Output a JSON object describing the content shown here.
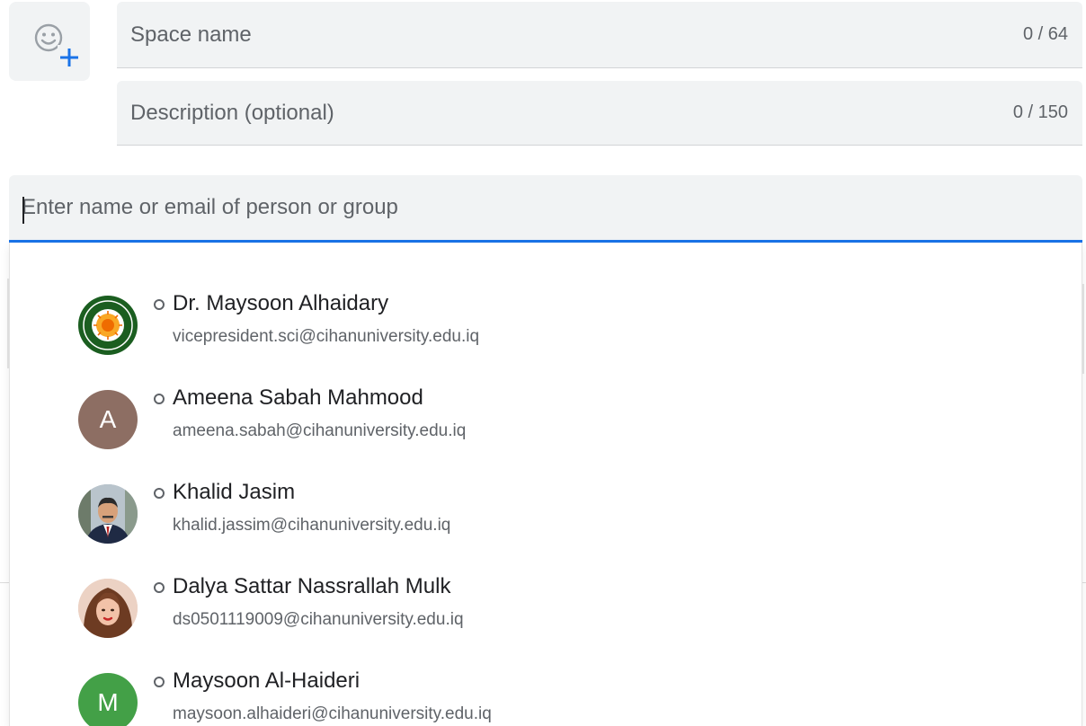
{
  "emoji_picker": {
    "icon": "add-emoji-icon"
  },
  "space_name": {
    "placeholder": "Space name",
    "value": "",
    "counter": "0 / 64"
  },
  "description": {
    "placeholder": "Description (optional)",
    "value": "",
    "counter": "0 / 150"
  },
  "people_search": {
    "placeholder": "Enter name or email of person or group",
    "value": ""
  },
  "colors": {
    "accent": "#1a73e8",
    "field_bg": "#f1f3f4",
    "avatar_a": "#8d6e63",
    "avatar_m": "#43a047"
  },
  "suggestions": [
    {
      "name": "Dr. Maysoon Alhaidary",
      "email": "vicepresident.sci@cihanuniversity.edu.iq",
      "avatar": "university-logo"
    },
    {
      "name": "Ameena Sabah Mahmood",
      "email": "ameena.sabah@cihanuniversity.edu.iq",
      "avatar": "A"
    },
    {
      "name": "Khalid Jasim",
      "email": "khalid.jassim@cihanuniversity.edu.iq",
      "avatar": "photo"
    },
    {
      "name": "Dalya Sattar Nassrallah Mulk",
      "email": "ds0501119009@cihanuniversity.edu.iq",
      "avatar": "photo"
    },
    {
      "name": "Maysoon Al-Haideri",
      "email": "maysoon.alhaideri@cihanuniversity.edu.iq",
      "avatar": "M"
    }
  ]
}
